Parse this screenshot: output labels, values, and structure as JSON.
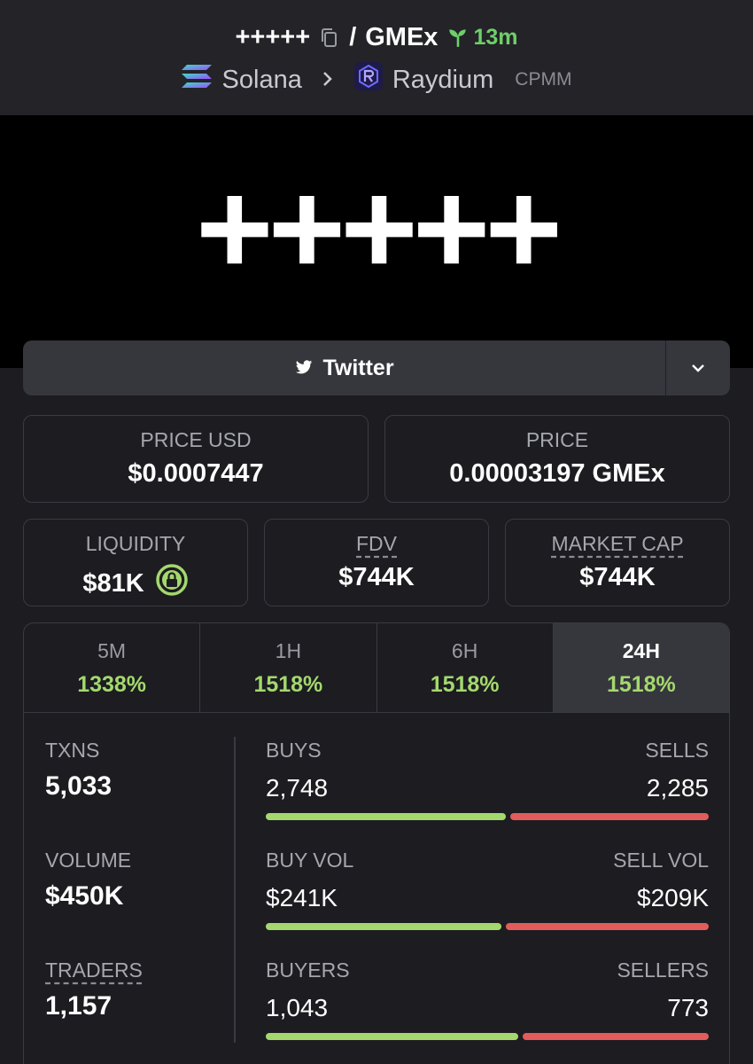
{
  "header": {
    "token_symbol": "+++++",
    "separator": "/",
    "quote_symbol": "GMEx",
    "age": "13m",
    "chain": "Solana",
    "dex": "Raydium",
    "pool_type": "CPMM"
  },
  "banner": {
    "text": "+++++"
  },
  "twitter": {
    "label": "Twitter"
  },
  "price_usd": {
    "label": "PRICE USD",
    "value": "$0.0007447"
  },
  "price_native": {
    "label": "PRICE",
    "value": "0.00003197 GMEx"
  },
  "liquidity": {
    "label": "LIQUIDITY",
    "value": "$81K"
  },
  "fdv": {
    "label": "FDV",
    "value": "$744K"
  },
  "market_cap": {
    "label": "MARKET CAP",
    "value": "$744K"
  },
  "tabs": [
    {
      "label": "5M",
      "value": "1338%"
    },
    {
      "label": "1H",
      "value": "1518%"
    },
    {
      "label": "6H",
      "value": "1518%"
    },
    {
      "label": "24H",
      "value": "1518%"
    }
  ],
  "stats": {
    "txns": {
      "label": "TXNS",
      "value": "5,033"
    },
    "volume": {
      "label": "VOLUME",
      "value": "$450K"
    },
    "traders": {
      "label": "TRADERS",
      "value": "1,157"
    }
  },
  "pairs": {
    "buys": {
      "label": "BUYS",
      "value": "2,748",
      "share": 0.546
    },
    "sells": {
      "label": "SELLS",
      "value": "2,285"
    },
    "buy_vol": {
      "label": "BUY VOL",
      "value": "$241K",
      "share": 0.535
    },
    "sell_vol": {
      "label": "SELL VOL",
      "value": "$209K"
    },
    "buyers": {
      "label": "BUYERS",
      "value": "1,043",
      "share": 0.574
    },
    "sellers": {
      "label": "SELLERS",
      "value": "773"
    }
  },
  "colors": {
    "green": "#a4d86e",
    "red": "#e25c5c",
    "age_green": "#6fcf6a"
  }
}
